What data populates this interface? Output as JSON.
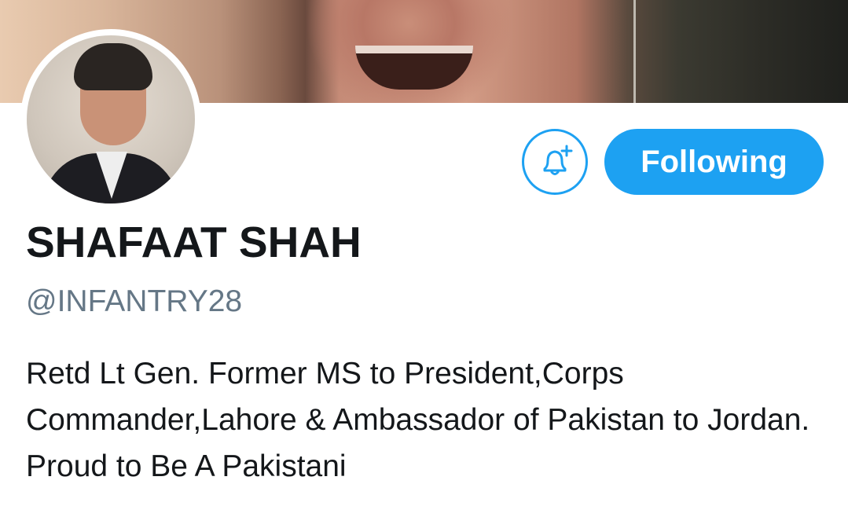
{
  "profile": {
    "display_name": "SHAFAAT SHAH",
    "handle": "@INFANTRY28",
    "bio": "Retd Lt Gen. Former MS to President,Corps Commander,Lahore & Ambassador of Pakistan to Jordan. Proud to Be A Pakistani"
  },
  "actions": {
    "notify_icon": "bell-plus-icon",
    "follow_label": "Following"
  },
  "colors": {
    "accent": "#1da1f2",
    "name_text": "#14171a",
    "handle_text": "#657786"
  }
}
